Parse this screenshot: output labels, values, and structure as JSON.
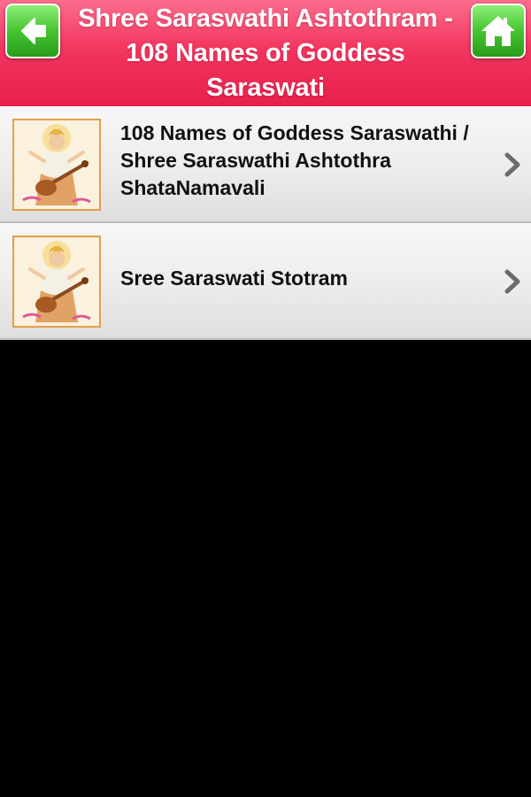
{
  "header": {
    "title": "Shree Saraswathi Ashtothram - 108 Names of Goddess Saraswati",
    "back_icon": "arrow-left-icon",
    "home_icon": "home-icon",
    "button_color": "#45c42f",
    "bar_color": "#f2365f"
  },
  "list": {
    "items": [
      {
        "label": "108 Names of Goddess Saraswathi / Shree Saraswathi Ashtothra ShataNamavali",
        "thumbnail": "goddess-saraswati-image",
        "chevron_icon": "chevron-right-icon"
      },
      {
        "label": "Sree Saraswati Stotram",
        "thumbnail": "goddess-saraswati-image",
        "chevron_icon": "chevron-right-icon"
      }
    ]
  }
}
